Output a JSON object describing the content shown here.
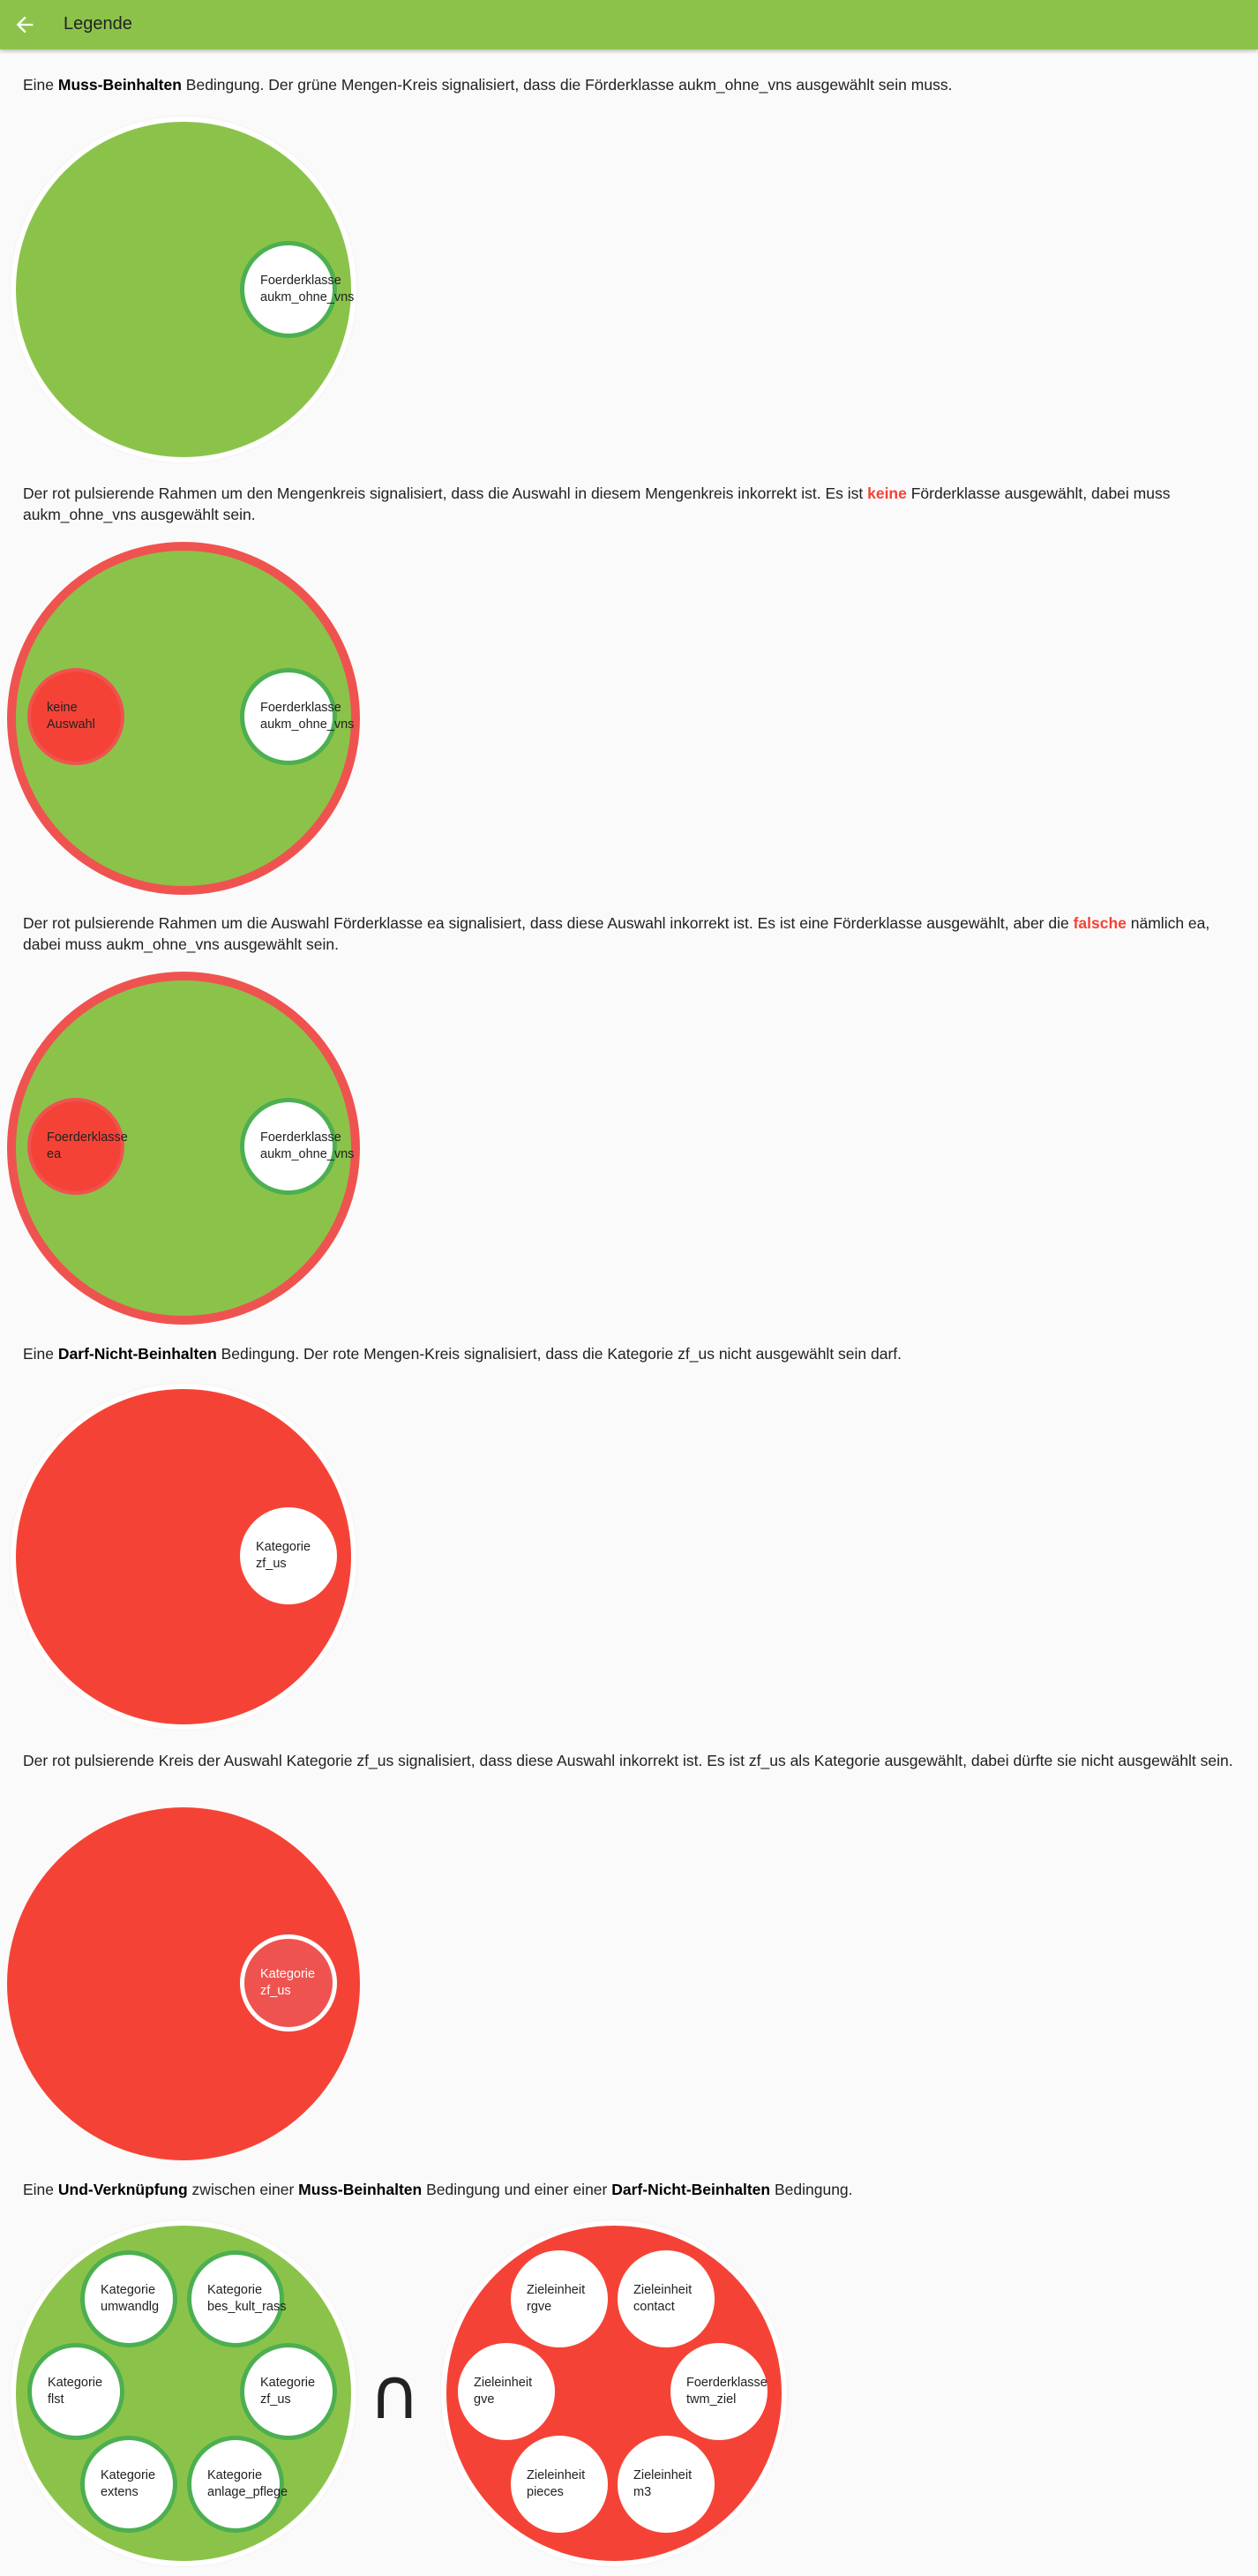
{
  "app": {
    "title": "Legende"
  },
  "sections": {
    "s1": {
      "p1": "Eine ",
      "b1": "Muss-Beinhalten",
      "p2": " Bedingung. Der grüne Mengen-Kreis signalisiert, dass die Förderklasse aukm_ohne_vns ausgewählt sein muss.",
      "item": {
        "l1": "Foerderklasse",
        "l2": "aukm_ohne_vns"
      }
    },
    "s2": {
      "p1": "Der rot pulsierende Rahmen um den Mengenkreis signalisiert, dass die Auswahl in diesem Mengenkreis inkorrekt ist. Es ist ",
      "r1": "keine",
      "p2": " Förderklasse ausgewählt, dabei muss aukm_ohne_vns ausgewählt sein.",
      "bad_item": {
        "l1": "keine Auswahl"
      },
      "item": {
        "l1": "Foerderklasse",
        "l2": "aukm_ohne_vns"
      }
    },
    "s3": {
      "p1": "Der rot pulsierende Rahmen um die Auswahl Förderklasse ea signalisiert, dass diese Auswahl inkorrekt ist. Es ist eine Förderklasse ausgewählt, aber die ",
      "r1": "falsche",
      "p2": " nämlich ea, dabei muss aukm_ohne_vns ausgewählt sein.",
      "bad_item": {
        "l1": "Foerderklasse",
        "l2": "ea"
      },
      "item": {
        "l1": "Foerderklasse",
        "l2": "aukm_ohne_vns"
      }
    },
    "s4": {
      "p1": "Eine ",
      "b1": "Darf-Nicht-Beinhalten",
      "p2": " Bedingung. Der rote Mengen-Kreis signalisiert, dass die Kategorie zf_us nicht ausgewählt sein darf.",
      "item": {
        "l1": "Kategorie",
        "l2": "zf_us"
      }
    },
    "s5": {
      "p1": "Der rot pulsierende Kreis der Auswahl Kategorie zf_us signalisiert, dass diese Auswahl inkorrekt ist. Es ist zf_us als Kategorie ausgewählt, dabei dürfte sie nicht ausgewählt sein.",
      "item": {
        "l1": "Kategorie",
        "l2": "zf_us"
      }
    },
    "s6": {
      "p1": "Eine ",
      "b1": "Und-Verknüpfung",
      "p2": " zwischen einer ",
      "b2": "Muss-Beinhalten",
      "p3": " Bedingung und einer einer ",
      "b3": "Darf-Nicht-Beinhalten",
      "p4": " Bedingung.",
      "symbol": "∩",
      "green_items": [
        {
          "l1": "Kategorie",
          "l2": "umwandlg"
        },
        {
          "l1": "Kategorie",
          "l2": "bes_kult_rass"
        },
        {
          "l1": "Kategorie",
          "l2": "flst"
        },
        {
          "l1": "Kategorie",
          "l2": "zf_us"
        },
        {
          "l1": "Kategorie",
          "l2": "extens"
        },
        {
          "l1": "Kategorie",
          "l2": "anlage_pflege"
        }
      ],
      "red_items": [
        {
          "l1": "Zieleinheit",
          "l2": "rgve"
        },
        {
          "l1": "Zieleinheit",
          "l2": "contact"
        },
        {
          "l1": "Zieleinheit",
          "l2": "gve"
        },
        {
          "l1": "Foerderklasse",
          "l2": "twm_ziel"
        },
        {
          "l1": "Zieleinheit",
          "l2": "pieces"
        },
        {
          "l1": "Zieleinheit",
          "l2": "m3"
        }
      ]
    }
  }
}
